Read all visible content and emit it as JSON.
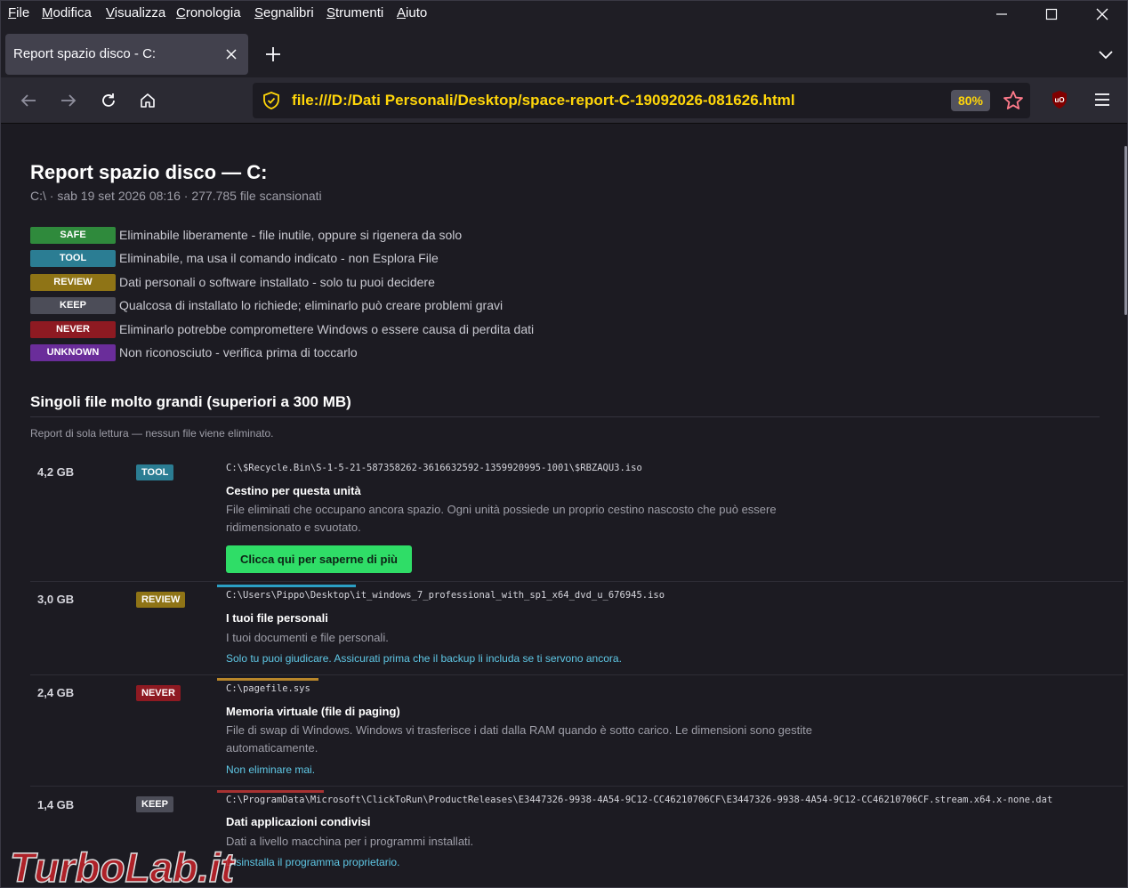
{
  "menubar": {
    "items": [
      "File",
      "Modifica",
      "Visualizza",
      "Cronologia",
      "Segnalibri",
      "Strumenti",
      "Aiuto"
    ]
  },
  "tab": {
    "title": "Report spazio disco - C:"
  },
  "urlbar": {
    "url": "file:///D:/Dati Personali/Desktop/space-report-C-19092026-081626.html",
    "zoom": "80%"
  },
  "page": {
    "title": "Report spazio disco — C:",
    "meta": "C:\\ · sab 19 set 2026 08:16 · 277.785 file scansionati",
    "legend": [
      {
        "badge": "SAFE",
        "text": "Eliminabile liberamente - file inutile, oppure si rigenera da solo",
        "color": "#2f8a3c"
      },
      {
        "badge": "TOOL",
        "text": "Eliminabile, ma usa il comando indicato - non Esplora File",
        "color": "#2b7d93"
      },
      {
        "badge": "REVIEW",
        "text": "Dati personali o software installato - solo tu puoi decidere",
        "color": "#8f7416"
      },
      {
        "badge": "KEEP",
        "text": "Qualcosa di installato lo richiede; eliminarlo può creare problemi gravi",
        "color": "#4c4d58"
      },
      {
        "badge": "NEVER",
        "text": "Eliminarlo potrebbe compromettere Windows o essere causa di perdita dati",
        "color": "#8e1a22"
      },
      {
        "badge": "UNKNOWN",
        "text": "Non riconosciuto - verifica prima di toccarlo",
        "color": "#6a2d9a"
      }
    ],
    "section_title": "Singoli file molto grandi (superiori a 300 MB)",
    "readonly_note": "Report di sola lettura — nessun file viene eliminato.",
    "rows": [
      {
        "size": "4,2 GB",
        "badge": "TOOL",
        "badge_color": "#2b7d93",
        "path": "C:\\$Recycle.Bin\\S-1-5-21-587358262-3616632592-1359920995-1001\\$RBZAQU3.iso",
        "title": "Cestino per questa unità",
        "desc": "File eliminati che occupano ancora spazio. Ogni unità possiede un proprio cestino nascosto che può essere ridimensionato e svuotato.",
        "cta": "Clicca qui per saperne di più"
      },
      {
        "size": "3,0 GB",
        "badge": "REVIEW",
        "badge_color": "#8f7416",
        "accent": "#2b9fc4",
        "path": "C:\\Users\\Pippo\\Desktop\\it_windows_7_professional_with_sp1_x64_dvd_u_676945.iso",
        "title": "I tuoi file personali",
        "desc": "I tuoi documenti e file personali.",
        "hint": "Solo tu puoi giudicare. Assicurati prima che il backup li includa se ti servono ancora."
      },
      {
        "size": "2,4 GB",
        "badge": "NEVER",
        "badge_color": "#8e1a22",
        "accent": "#b8862a",
        "path": "C:\\pagefile.sys",
        "title": "Memoria virtuale (file di paging)",
        "desc": "File di swap di Windows. Windows vi trasferisce i dati dalla RAM quando è sotto carico. Le dimensioni sono gestite automaticamente.",
        "hint": "Non eliminare mai."
      },
      {
        "size": "1,4 GB",
        "badge": "KEEP",
        "badge_color": "#4c4d58",
        "accent": "#a83232",
        "path": "C:\\ProgramData\\Microsoft\\ClickToRun\\ProductReleases\\E3447326-9938-4A54-9C12-CC46210706CF\\E3447326-9938-4A54-9C12-CC46210706CF.stream.x64.x-none.dat",
        "title": "Dati applicazioni condivisi",
        "desc": "Dati a livello macchina per i programmi installati.",
        "hint": "Disinstalla il programma proprietario."
      }
    ]
  },
  "watermark": {
    "text": "TurboLab.it"
  },
  "colors": {
    "url": "#ffd60a",
    "link": "#5fc8e6",
    "cta": "#2fdd67",
    "bg": "#1c1b22"
  }
}
